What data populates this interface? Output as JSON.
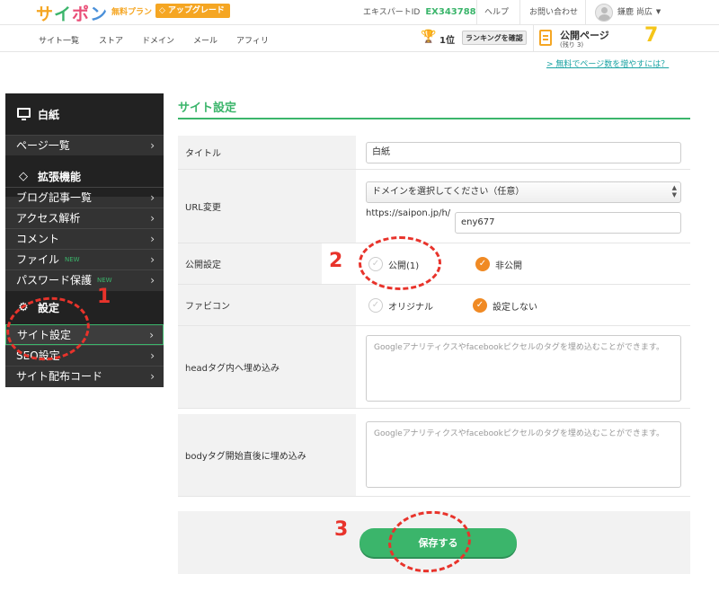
{
  "header": {
    "logo": [
      "サ",
      "イ",
      "ポ",
      "ン"
    ],
    "plan": "無料プラン",
    "upgrade_label": "アップグレード",
    "expert_label": "エキスパートID",
    "expert_id": "EX343788",
    "help": "ヘルプ",
    "contact": "お問い合わせ",
    "user_name": "鎌鹿 尚広"
  },
  "nav": {
    "items": [
      "サイト一覧",
      "ストア",
      "ドメイン",
      "メール",
      "アフィリ"
    ],
    "rank": "1位",
    "rank_button": "ランキングを確認",
    "publish_title": "公開ページ",
    "publish_remaining": "(残り 3)",
    "publish_count": "7",
    "more_link": "> 無料でページ数を増やすには？"
  },
  "sidebar": {
    "site_name": "白紙",
    "pages": "ページ一覧",
    "extensions": "拡張機能",
    "ext_items": [
      "ブログ記事一覧",
      "アクセス解析",
      "コメント",
      "ファイル",
      "パスワード保護"
    ],
    "new_badge": "NEW",
    "settings": "設定",
    "set_items": [
      "サイト設定",
      "SEO設定",
      "サイト配布コード"
    ],
    "chevron": "›"
  },
  "main": {
    "title": "サイト設定",
    "title_label": "タイトル",
    "title_value": "白紙",
    "url_label": "URL変更",
    "domain_select": "ドメインを選択してください（任意）",
    "url_prefix": "https://saipon.jp/h/",
    "url_value": "eny677",
    "publish_label": "公開設定",
    "publish_on": "公開(1)",
    "publish_off": "非公開",
    "favicon_label": "ファビコン",
    "favicon_original": "オリジナル",
    "favicon_none": "設定しない",
    "head_label": "headタグ内へ埋め込み",
    "head_placeholder": "Googleアナリティクスやfacebookピクセルのタグを埋め込むことができます。",
    "body_label": "bodyタグ開始直後に埋め込み",
    "body_placeholder": "Googleアナリティクスやfacebookピクセルのタグを埋め込むことができます。",
    "save": "保存する"
  },
  "annotations": [
    "1",
    "2",
    "3"
  ],
  "colors": {
    "accent": "#3bb56b",
    "orange": "#f08a24",
    "annotation": "#e8332b"
  }
}
